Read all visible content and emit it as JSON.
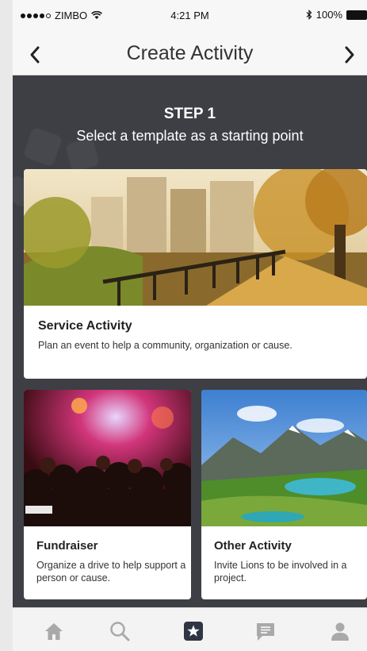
{
  "status_bar": {
    "carrier": "ZIMBO",
    "time": "4:21 PM",
    "battery": "100%"
  },
  "nav": {
    "title": "Create Activity",
    "back_icon": "chevron-left-icon",
    "forward_icon": "chevron-right-icon"
  },
  "header": {
    "step": "STEP 1",
    "subtitle": "Select a template as a starting point"
  },
  "templates": [
    {
      "title": "Service Activity",
      "description": "Plan an event to help a community, organization or cause.",
      "image": "sunlit-city-park-photo"
    },
    {
      "title": "Fundraiser",
      "description": "Organize a drive to help support a person or cause.",
      "image": "concert-crowd-photo"
    },
    {
      "title": "Other Activity",
      "description": "Invite Lions to be involved in a project.",
      "image": "mountain-lake-photo"
    }
  ],
  "tabbar": {
    "items": [
      {
        "icon": "home-icon",
        "active": false
      },
      {
        "icon": "search-icon",
        "active": false
      },
      {
        "icon": "star-icon",
        "active": true
      },
      {
        "icon": "chat-icon",
        "active": false
      },
      {
        "icon": "profile-icon",
        "active": false
      }
    ]
  },
  "colors": {
    "dark_bg": "#3d3f44",
    "active_tab": "#2f3542",
    "inactive_tab": "#a9a9a9"
  }
}
